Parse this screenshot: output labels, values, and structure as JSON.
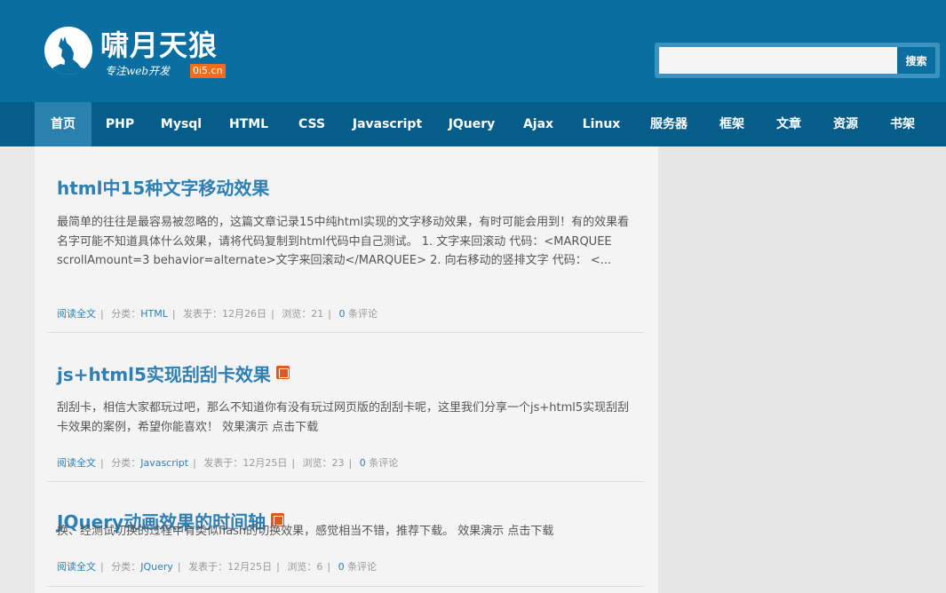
{
  "header": {
    "site_title": "啸月天狼",
    "tagline": "专注web开发",
    "badge": "0i5.cn",
    "search": {
      "placeholder": "",
      "button_label": "搜索"
    }
  },
  "nav": {
    "items": [
      {
        "label": "首页",
        "active": true
      },
      {
        "label": "PHP"
      },
      {
        "label": "Mysql"
      },
      {
        "label": "HTML"
      },
      {
        "label": "CSS"
      },
      {
        "label": "Javascript"
      },
      {
        "label": "JQuery"
      },
      {
        "label": "Ajax"
      },
      {
        "label": "Linux"
      },
      {
        "label": "服务器"
      },
      {
        "label": "框架"
      },
      {
        "label": "文章"
      },
      {
        "label": "资源"
      },
      {
        "label": "书架"
      }
    ]
  },
  "posts": [
    {
      "title": "html中15种文字移动效果",
      "excerpt": "最简单的往往是最容易被忽略的，这篇文章记录15中纯html实现的文字移动效果，有时可能会用到！有的效果看名字可能不知道具体什么效果，请将代码复制到html代码中自己测试。 1. 文字来回滚动 代码：<MARQUEE scrollAmount=3 behavior=alternate>文字来回滚动</MARQUEE>   2. 向右移动的竖排文字 代码： <...",
      "meta": {
        "read_more": "阅读全文",
        "category_label": "分类：",
        "category": "HTML",
        "date": "发表于：12月26日",
        "views": "浏览：21",
        "comments_count": "0",
        "comments_label": "条评论"
      }
    },
    {
      "title": "js+html5实现刮刮卡效果",
      "excerpt": "刮刮卡，相信大家都玩过吧，那么不知道你有没有玩过网页版的刮刮卡呢，这里我们分享一个js+html5实现刮刮卡效果的案例，希望你能喜欢！ 效果演示     点击下载",
      "meta": {
        "read_more": "阅读全文",
        "category_label": "分类：",
        "category": "Javascript",
        "date": "发表于：12月25日",
        "views": "浏览：23",
        "comments_count": "0",
        "comments_label": "条评论"
      }
    },
    {
      "title": "JQuery动画效果的时间轴",
      "excerpt": "换、经测试切换的过程中有类似flash的切换效果，感觉相当不错，推荐下载。 效果演示     点击下载",
      "meta": {
        "read_more": "阅读全文",
        "category_label": "分类：",
        "category": "JQuery",
        "date": "发表于：12月25日",
        "views": "浏览：6",
        "comments_count": "0",
        "comments_label": "条评论"
      }
    }
  ],
  "colors": {
    "header_bg": "#0a6fa0",
    "nav_bg": "#075d89",
    "nav_active_bg": "#2a80ae",
    "link": "#2e7fb3",
    "badge": "#f36b1c",
    "icon_badge": "#e2571e"
  },
  "icons": [
    "wolf-logo-icon",
    "picture-icon"
  ]
}
